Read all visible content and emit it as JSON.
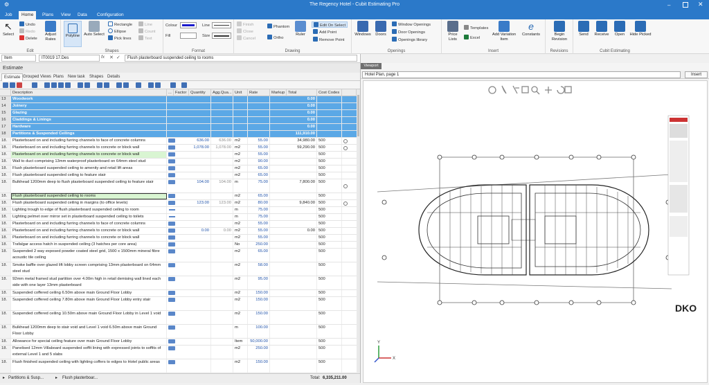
{
  "window": {
    "title": "The Regency Hotel - Cubit Estimating Pro"
  },
  "ribbon_tabs": [
    "Job",
    "Home",
    "Plans",
    "View",
    "Data",
    "Configuration"
  ],
  "ribbon": {
    "edit": {
      "label": "Edit",
      "select": "Select",
      "undo": "Undo",
      "redo": "Redo",
      "delete": "Delete",
      "adjust_rates": "Adjust Rates"
    },
    "shapes": {
      "label": "Shapes",
      "polyline": "Polyline",
      "auto_select": "Auto Select",
      "rectangle": "Rectangle",
      "ellipse": "Ellipse",
      "pick_lines": "Pick lines",
      "line": "Line",
      "count": "Count",
      "text": "Text"
    },
    "format": {
      "label": "Format",
      "colour": "Colour",
      "fill": "Fill",
      "line": "Line",
      "size": "Size"
    },
    "drawing": {
      "label": "Drawing",
      "finish": "Finish",
      "close": "Close",
      "cancel": "Cancel",
      "phantom": "Phantom",
      "ortho": "Ortho",
      "ruler": "Ruler",
      "edit_on_select": "Edit On Select",
      "add_point": "Add Point",
      "remove_point": "Remove Point"
    },
    "openings": {
      "label": "Openings",
      "windows": "Windows",
      "doors": "Doors",
      "window_openings": "Window Openings",
      "door_openings": "Door Openings",
      "openings_library": "Openings library"
    },
    "insert": {
      "label": "Insert",
      "price_lists": "Price Lists",
      "templates": "Templates",
      "excel": "Excel",
      "add_variation_item": "Add Variation Item",
      "constants": "Constants"
    },
    "revisions": {
      "label": "Revisions",
      "begin_revision": "Begin Revision"
    },
    "cubit_estimating": {
      "label": "Cubit Estimating",
      "send": "Send",
      "receive": "Receive",
      "open": "Open",
      "hide_picked": "Hide Picked"
    }
  },
  "formula_bar": {
    "field": "Item",
    "code": "IT0019 17.Des",
    "fx": "fx",
    "value": "Flush plasterboard suspended ceiling to rooms"
  },
  "estimate": {
    "header": "Estimate",
    "tabs": [
      "Estimate",
      "Grouped Views",
      "Plans",
      "New task",
      "Shapes",
      "Details"
    ],
    "columns": [
      "Description",
      "...",
      "Factor",
      "Quantity",
      "Agg.Qua...",
      "Unit",
      "Rate",
      "Markup",
      "Total",
      "Cost Codes"
    ],
    "rows": [
      {
        "n": "13",
        "desc": "Woodwork",
        "total": "0.00",
        "type": "hdr"
      },
      {
        "n": "14",
        "desc": "Joinery",
        "total": "0.00",
        "type": "hdr"
      },
      {
        "n": "15",
        "desc": "Glazing",
        "total": "0.00",
        "type": "hdr"
      },
      {
        "n": "16",
        "desc": "Claddings & Linings",
        "total": "0.00",
        "type": "hdr"
      },
      {
        "n": "17",
        "desc": "Hardware",
        "total": "0.00",
        "type": "hdr"
      },
      {
        "n": "18",
        "desc": "Partitions & Suspended Ceilings",
        "total": "111,910.00",
        "type": "hdr"
      },
      {
        "n": "18.",
        "desc": "Plasterboard on and including furring channels to face of concrete columns",
        "qty": "636.00",
        "agg": "636.00",
        "unit": "m2",
        "rate": "55.00",
        "total": "34,980.00",
        "cc": "500",
        "circle": true
      },
      {
        "n": "18.",
        "desc": "Plasterboard on and including furring channels to concrete or block wall",
        "qty": "1,078.00",
        "agg": "1,078.00",
        "unit": "m2",
        "rate": "55.00",
        "total": "59,290.00",
        "cc": "500",
        "circle": true
      },
      {
        "n": "18.",
        "desc": "Plasterboard on and including furring channels to concrete or block wall",
        "unit": "m2",
        "rate": "55.00",
        "cc": "500",
        "type": "green"
      },
      {
        "n": "18.",
        "desc": "Wall to duct comprising 13mm waterproof plasterboard on 64mm steel stud",
        "unit": "m2",
        "rate": "90.00",
        "cc": "500"
      },
      {
        "n": "18.",
        "desc": "Flush plasterboard suspended ceiling to amenity and retail lift areas",
        "unit": "m2",
        "rate": "65.00",
        "cc": "500"
      },
      {
        "n": "18.",
        "desc": "Flush plasterboard suspended ceiling to feature stair",
        "unit": "m2",
        "rate": "65.00",
        "cc": "500"
      },
      {
        "n": "18.",
        "desc": "Bulkhead 1200mm deep to flush plasterboard suspended ceiling to feature stair",
        "qty": "104.00",
        "agg": "104.00",
        "unit": "m",
        "rate": "75.00",
        "total": "7,800.00",
        "cc": "500",
        "circle": true,
        "h": 2
      },
      {
        "n": "18.",
        "desc": "Flush plasterboard suspended ceiling to rooms",
        "unit": "m2",
        "rate": "65.00",
        "cc": "500",
        "type": "sel"
      },
      {
        "n": "18.",
        "desc": "Flush plasterboard suspended ceiling in margins (to office levels)",
        "qty": "123.00",
        "agg": "123.00",
        "unit": "m2",
        "rate": "80.00",
        "total": "9,840.00",
        "cc": "500",
        "circle": true
      },
      {
        "n": "18.",
        "desc": "Lighting trough to edge of flush plasterboard suspended ceiling to room",
        "unit": "m",
        "rate": "75.00",
        "cc": "500",
        "dash": true
      },
      {
        "n": "18.",
        "desc": "Lighting pelmet over mirror set in plasterboard suspended ceiling to toilets",
        "unit": "m",
        "rate": "75.00",
        "cc": "500",
        "dash": true
      },
      {
        "n": "18.",
        "desc": "Plasterboard on and including furring channels to face of concrete columns",
        "unit": "m2",
        "rate": "55.00",
        "cc": "500"
      },
      {
        "n": "18.",
        "desc": "Plasterboard on and including furring channels to concrete or block wall",
        "qty": "0.00",
        "agg": "0.00",
        "unit": "m2",
        "rate": "55.00",
        "total": "0.00",
        "cc": "500"
      },
      {
        "n": "18.",
        "desc": "Plasterboard on and including furring channels to concrete or block wall",
        "unit": "m2",
        "rate": "55.00",
        "cc": "500"
      },
      {
        "n": "18.",
        "desc": "Trafalgar access hatch in suspended ceiling (3 hatches per core area)",
        "unit": "No",
        "rate": "250.00",
        "cc": "500"
      },
      {
        "n": "18.",
        "desc": "Suspended 2 way exposed powder coated steel grid, 1500 x 1500mm mineral fibre acoustic tile ceiling",
        "unit": "m2",
        "rate": "65.00",
        "cc": "500",
        "h": 2
      },
      {
        "n": "18.",
        "desc": "Smoke baffle over glazed lift lobby screen comprising 13mm plasterboard on 64mm steel stud",
        "unit": "m2",
        "rate": "58.00",
        "cc": "500",
        "h": 2
      },
      {
        "n": "18.",
        "desc": "92mm metal framed stud partition over 4.00m high in retail demising wall lined each side with one layer 13mm plasterboard",
        "unit": "m2",
        "rate": "95.00",
        "cc": "500",
        "h": 2
      },
      {
        "n": "18.",
        "desc": "Suspended coffered ceiling 6.50m above main Ground Floor Lobby",
        "unit": "m2",
        "rate": "150.00",
        "cc": "500"
      },
      {
        "n": "18.",
        "desc": "Suspended coffered ceiling 7.80m above main Ground Floor Lobby entry stair",
        "unit": "m2",
        "rate": "150.00",
        "cc": "500",
        "h": 2
      },
      {
        "n": "18.",
        "desc": "Suspended coffered ceiling 10.50m above main Ground Floor Lobby in Level 1 void",
        "unit": "m2",
        "rate": "150.00",
        "cc": "500",
        "h": 2
      },
      {
        "n": "18.",
        "desc": "Bulkhead 1200mm deep to stair void and Level 1 void 6.50m above main Ground Floor Lobby",
        "unit": "m",
        "rate": "100.00",
        "cc": "500",
        "h": 2
      },
      {
        "n": "18.",
        "desc": "Allowance for special ceiling feature over main Ground Floor Lobby",
        "unit": "Item",
        "rate": "50,000.00",
        "cc": "500"
      },
      {
        "n": "18.",
        "desc": "Panelised 12mm Villaboard suspended soffit lining with expressed joints to soffits of external Level 1 and 5 slabs",
        "unit": "m2",
        "rate": "250.00",
        "cc": "500",
        "h": 2
      },
      {
        "n": "18.",
        "desc": "Flush finished suspended ceiling with lighting coffers to edges to Hotel public areas",
        "unit": "m2",
        "rate": "150.00",
        "cc": "500",
        "h": 2
      },
      {
        "n": "18.",
        "desc": "Extra over flush finished suspended ceiling with lighting coffers to edges to Hotel back of house areas for Ceiling Features",
        "unit": "m2",
        "rate": "200.00",
        "cc": "500",
        "h": 2
      }
    ]
  },
  "statusbar": {
    "path1": "Partitions & Susp...",
    "path2": "Flush plasterboar...",
    "total_label": "Total:",
    "total_value": "6,335,211.00"
  },
  "viewport": {
    "tab": "Viewport",
    "select": "Hotel Plan, page 1",
    "insert": "Insert",
    "logo": "DKO",
    "axis_y": "Y",
    "axis_x": "X",
    "page_tab": "Hotel Plan, page 1"
  },
  "colors": {
    "accent": "#2b79c9",
    "header_row": "#5ba8e6",
    "green_row": "#d9f5d2"
  }
}
